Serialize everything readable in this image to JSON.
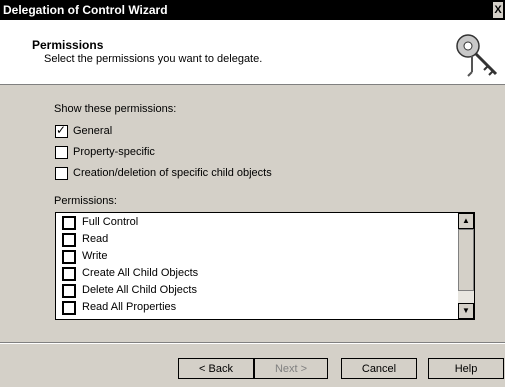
{
  "window": {
    "title": "Delegation of Control Wizard",
    "close_glyph": "X"
  },
  "header": {
    "title": "Permissions",
    "subtitle": "Select the permissions you want to delegate.",
    "icon": "keys-icon"
  },
  "show_permissions": {
    "label": "Show these permissions:",
    "options": [
      {
        "label": "General",
        "checked": true
      },
      {
        "label": "Property-specific",
        "checked": false
      },
      {
        "label": "Creation/deletion of specific child objects",
        "checked": false
      }
    ]
  },
  "permissions": {
    "label": "Permissions:",
    "items": [
      {
        "label": "Full Control",
        "checked": false
      },
      {
        "label": "Read",
        "checked": false
      },
      {
        "label": "Write",
        "checked": false
      },
      {
        "label": "Create All Child Objects",
        "checked": false
      },
      {
        "label": "Delete All Child Objects",
        "checked": false
      },
      {
        "label": "Read All Properties",
        "checked": false
      }
    ]
  },
  "buttons": {
    "back": "< Back",
    "next": "Next >",
    "cancel": "Cancel",
    "help": "Help"
  },
  "colors": {
    "titlebar": "#000000",
    "dialog": "#d4d0c8",
    "disabled_text": "#808080"
  }
}
